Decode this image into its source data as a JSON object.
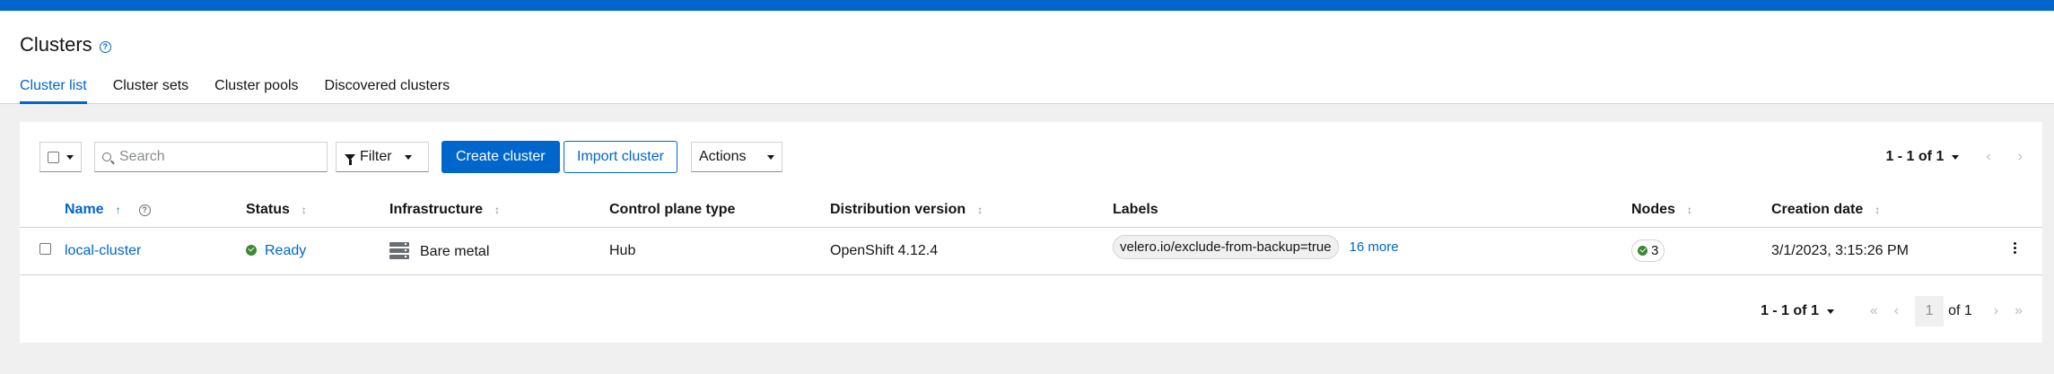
{
  "page": {
    "title": "Clusters",
    "tabs": [
      {
        "label": "Cluster list",
        "active": true
      },
      {
        "label": "Cluster sets",
        "active": false
      },
      {
        "label": "Cluster pools",
        "active": false
      },
      {
        "label": "Discovered clusters",
        "active": false
      }
    ]
  },
  "toolbar": {
    "search_placeholder": "Search",
    "filter_label": "Filter",
    "create_label": "Create cluster",
    "import_label": "Import cluster",
    "actions_label": "Actions",
    "pagination": "1 - 1 of 1"
  },
  "table": {
    "columns": [
      "Name",
      "Status",
      "Infrastructure",
      "Control plane type",
      "Distribution version",
      "Labels",
      "Nodes",
      "Creation date"
    ],
    "rows": [
      {
        "name": "local-cluster",
        "status": "Ready",
        "infrastructure": "Bare metal",
        "control_plane": "Hub",
        "distribution": "OpenShift 4.12.4",
        "label": "velero.io/exclude-from-backup=true",
        "more_labels": "16 more",
        "nodes": "3",
        "created": "3/1/2023, 3:15:26 PM"
      }
    ]
  },
  "bottom_pagination": {
    "range": "1 - 1 of 1",
    "page": "1",
    "of_pages": "of 1"
  },
  "colors": {
    "accent": "#0066cc",
    "success": "#3e8635"
  }
}
